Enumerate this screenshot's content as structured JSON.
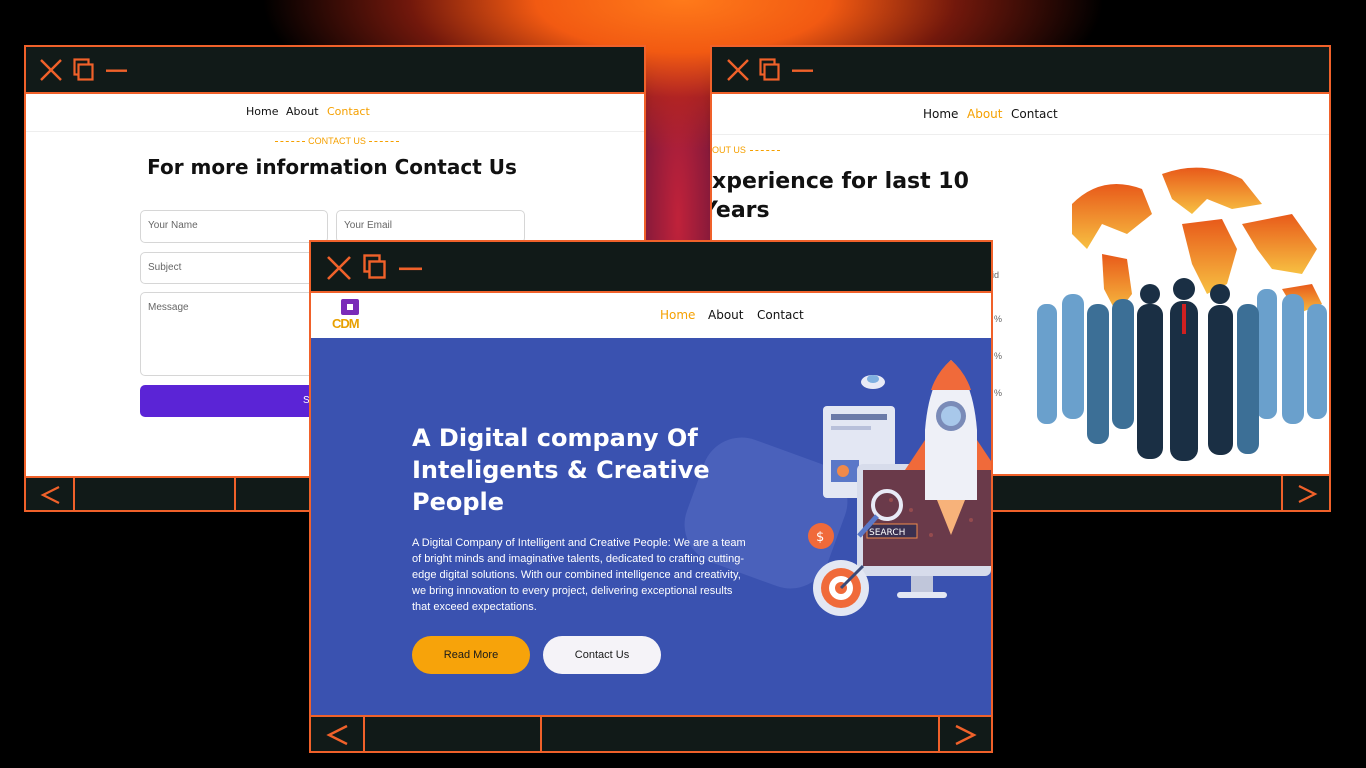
{
  "windows": {
    "contact": {
      "nav": {
        "home": "Home",
        "about": "About",
        "contact": "Contact"
      },
      "eyebrow": "CONTACT US",
      "heading": "For more information Contact Us",
      "form": {
        "name_placeholder": "Your Name",
        "email_placeholder": "Your Email",
        "subject_placeholder": "Subject",
        "message_placeholder": "Message",
        "submit_label": "Se"
      }
    },
    "about": {
      "nav": {
        "home": "Home",
        "about": "About",
        "contact": "Contact"
      },
      "eyebrow": "OUT US",
      "heading_line1": "xperience for last 10",
      "heading_line2": "Years",
      "side_text": {
        "a": "id",
        "b": "%",
        "c": "%",
        "d": "%"
      }
    },
    "home": {
      "logo_text": "CDM",
      "nav": {
        "home": "Home",
        "about": "About",
        "contact": "Contact"
      },
      "hero": {
        "title_line1": "A Digital company Of",
        "title_line2": "Inteligents & Creative",
        "title_line3": "People",
        "desc_line1": "A Digital Company of Intelligent and Creative People: We are a team",
        "desc_line2": "of bright minds and imaginative talents, dedicated to crafting cutting-",
        "desc_line3": "edge digital solutions. With our combined intelligence and creativity,",
        "desc_line4": "we bring innovation to every project, delivering exceptional results",
        "desc_line5": "that exceed expectations.",
        "read_more": "Read More",
        "contact_us": "Contact Us"
      },
      "illustration": {
        "search_label": "SEARCH"
      }
    }
  },
  "colors": {
    "accent": "#f0612a",
    "nav_active": "#f5a000",
    "hero_bg": "#3a52b0",
    "submit": "#5b24d6",
    "read_more_bg": "#f7a30a"
  },
  "icons": [
    "close-icon",
    "restore-icon",
    "minimize-icon",
    "prev-arrow-icon",
    "next-arrow-icon"
  ]
}
